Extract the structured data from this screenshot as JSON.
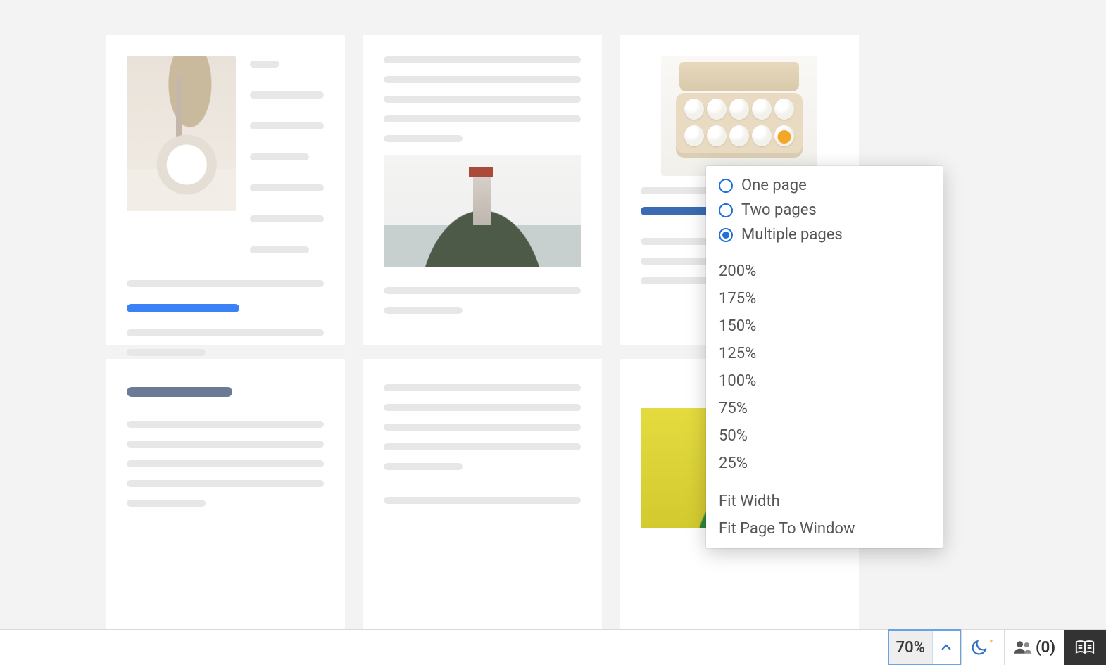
{
  "zoom_menu": {
    "page_modes": [
      {
        "label": "One page",
        "selected": false
      },
      {
        "label": "Two pages",
        "selected": false
      },
      {
        "label": "Multiple pages",
        "selected": true
      }
    ],
    "zoom_levels": [
      "200%",
      "175%",
      "150%",
      "125%",
      "100%",
      "75%",
      "50%",
      "25%"
    ],
    "fit_options": [
      "Fit Width",
      "Fit Page To Window"
    ]
  },
  "statusbar": {
    "zoom_value": "70%",
    "collaborators_label": "(0)"
  }
}
